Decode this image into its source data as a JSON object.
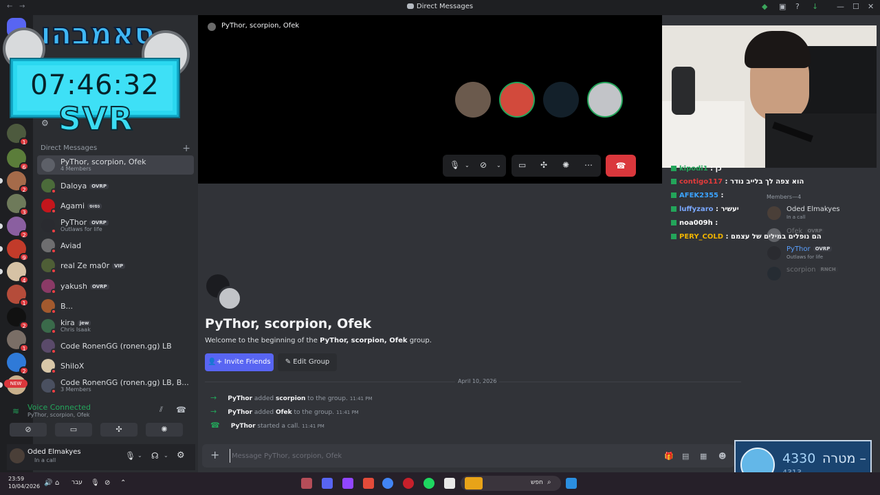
{
  "window": {
    "title": "Direct Messages"
  },
  "overlay": {
    "clock": "07:46:32",
    "tag": "SVR",
    "brand": "סאמבהו"
  },
  "sidebar": {
    "section_title": "Direct Messages",
    "dms": [
      {
        "name": "PyThor, scorpion, Ofek",
        "sub": "4 Members",
        "color": "#5d6068"
      },
      {
        "name": "Daloya",
        "tag": "OVRP",
        "sub": "",
        "color": "#4b6b3a"
      },
      {
        "name": "Agami",
        "tag": "נסוס",
        "sub": "",
        "color": "#c4161c"
      },
      {
        "name": "PyThor",
        "tag": "OVRP",
        "sub": "Outlaws for life",
        "color": "#2a2b30"
      },
      {
        "name": "Aviad",
        "sub": "",
        "color": "#6e6e70"
      },
      {
        "name": "real Ze ma0r",
        "tag": "VIP",
        "sub": "",
        "color": "#4e5e36"
      },
      {
        "name": "yakush",
        "tag": "OVRP",
        "sub": "",
        "color": "#8a3a66"
      },
      {
        "name": "B...",
        "sub": "",
        "color": "#a35a2e"
      },
      {
        "name": "kira",
        "tag": "jew",
        "sub": "Chris Isaak",
        "color": "#3a6a4a"
      },
      {
        "name": "Code RonenGG (ronen.gg) LB",
        "sub": "",
        "color": "#5a4a6a"
      },
      {
        "name": "ShiloX",
        "sub": "",
        "color": "#d8c7a8"
      },
      {
        "name": "Code RonenGG (ronen.gg) LB, B...",
        "sub": "3 Members",
        "color": "#4a5060"
      }
    ],
    "voice": {
      "title": "Voice Connected",
      "sub": "PyThor, scorpion, Ofek"
    },
    "user": {
      "name": "Oded Elmakyes",
      "status": "In a call"
    }
  },
  "call": {
    "title": "PyThor, scorpion, Ofek"
  },
  "chat_overlay": [
    {
      "user": "kipodi1",
      "text": "כן",
      "color": "#23a55a"
    },
    {
      "user": "contigo117",
      "text": "הוא צפה לך בלייב נודר",
      "color": "#e33b3b"
    },
    {
      "user": "AFEK2355",
      "text": "",
      "color": "#3ba3ff"
    },
    {
      "user": "luffyzaro",
      "text": "יעשיר",
      "color": "#7aa8ff"
    },
    {
      "user": "noa009h",
      "text": "",
      "color": "#ffffff"
    },
    {
      "user": "PERY_COLD",
      "text": "הם נופלים במילים של עצמם",
      "color": "#f0b400"
    }
  ],
  "members": {
    "header": "Members—4",
    "list": [
      {
        "name": "Oded Elmakyes",
        "sub": "In a call"
      },
      {
        "name": "Ofek",
        "tag": "OVRP",
        "sub": ""
      },
      {
        "name": "PyThor",
        "tag": "OVRP",
        "sub": "Outlaws for life"
      },
      {
        "name": "scorpion",
        "tag": "RNCH",
        "sub": ""
      }
    ]
  },
  "group": {
    "title": "PyThor, scorpion, Ofek",
    "welcome_prefix": "Welcome to the beginning of the",
    "welcome_name": "PyThor, scorpion, Ofek",
    "welcome_suffix": "group.",
    "invite_label": "Invite Friends",
    "edit_label": "Edit Group"
  },
  "messages": {
    "date": "April 10, 2026",
    "items": [
      {
        "actor": "PyThor",
        "verb": "added",
        "target": "scorpion",
        "rest": "to the group.",
        "time": "11:41 PM"
      },
      {
        "actor": "PyThor",
        "verb": "added",
        "target": "Ofek",
        "rest": "to the group.",
        "time": "11:41 PM"
      },
      {
        "actor": "PyThor",
        "verb": "started a call.",
        "target": "",
        "rest": "",
        "time": "11:41 PM"
      }
    ]
  },
  "composer": {
    "placeholder": "Message PyThor, scorpion, Ofek"
  },
  "goal": {
    "count": "4330",
    "label": "מטרה –",
    "sub": "4313"
  },
  "taskbar": {
    "time": "23:59",
    "date": "10/04/2026",
    "lang": "עבר",
    "search": "חפש"
  }
}
